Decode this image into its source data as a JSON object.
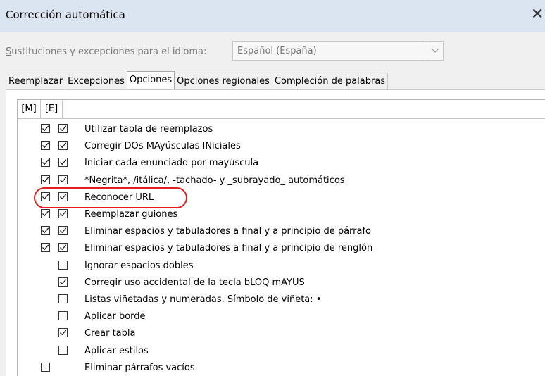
{
  "window": {
    "title": "Corrección automática"
  },
  "language": {
    "label_prefix": "S",
    "label_rest": "ustituciones y excepciones para el idioma:",
    "value": "Español (España)"
  },
  "tabs": [
    "Reemplazar",
    "Excepciones",
    "Opciones",
    "Opciones regionales",
    "Compleción de palabras"
  ],
  "active_tab": "Opciones",
  "list": {
    "headers": [
      "[M]",
      "[E]"
    ],
    "rows": [
      {
        "m": true,
        "e": true,
        "label": "Utilizar tabla de reemplazos"
      },
      {
        "m": true,
        "e": true,
        "label": "Corregir DOs MAyúsculas INiciales"
      },
      {
        "m": true,
        "e": true,
        "label": "Iniciar cada enunciado por mayúscula"
      },
      {
        "m": true,
        "e": true,
        "label": "*Negrita*, /itálica/, -tachado- y _subrayado_ automáticos"
      },
      {
        "m": true,
        "e": true,
        "label": "Reconocer URL"
      },
      {
        "m": true,
        "e": true,
        "label": "Reemplazar guiones"
      },
      {
        "m": true,
        "e": true,
        "label": "Eliminar espacios y tabuladores a final y a principio de párrafo"
      },
      {
        "m": true,
        "e": true,
        "label": "Eliminar espacios y tabuladores a final y a principio de renglón"
      },
      {
        "m": null,
        "e": false,
        "label": "Ignorar espacios dobles"
      },
      {
        "m": null,
        "e": true,
        "label": "Corregir uso accidental de la tecla bLOQ mAYÚS"
      },
      {
        "m": null,
        "e": false,
        "label": "Listas viñetadas y numeradas. Símbolo de viñeta: •"
      },
      {
        "m": null,
        "e": false,
        "label": "Aplicar borde"
      },
      {
        "m": null,
        "e": true,
        "label": "Crear tabla"
      },
      {
        "m": null,
        "e": false,
        "label": "Aplicar estilos"
      },
      {
        "m": false,
        "e": null,
        "label": "Eliminar párrafos vacíos"
      }
    ]
  },
  "highlighted_item": "Reconocer URL",
  "colors": {
    "titlebar": "#dbe5f1",
    "highlight": "#e02020"
  }
}
